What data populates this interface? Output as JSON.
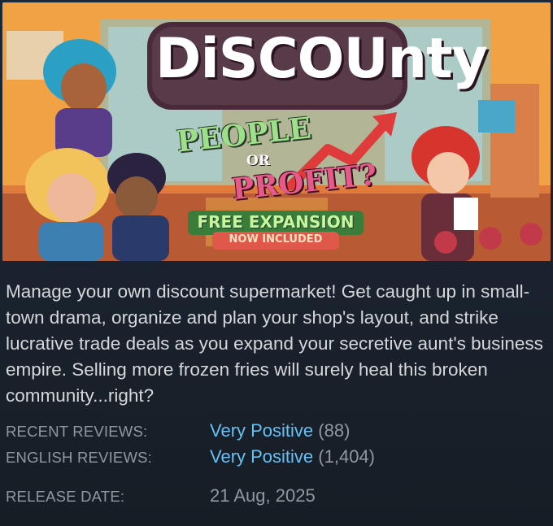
{
  "capsule": {
    "logo_text": "DiSCOUnty",
    "tagline_top": "PEOPLE",
    "tagline_mid": "OR",
    "tagline_bottom": "PROFIT?",
    "badge_line1": "FREE EXPANSION",
    "badge_line2": "NOW INCLUDED"
  },
  "description": "Manage your own discount supermarket! Get caught up in small-town drama, organize and plan your shop's layout, and strike lucrative trade deals as you expand your secretive aunt's business empire. Selling more frozen fries will surely heal this broken community...right?",
  "reviews": {
    "recent_label": "RECENT REVIEWS:",
    "recent_summary": "Very Positive",
    "recent_count": "(88)",
    "english_label": "ENGLISH REVIEWS:",
    "english_summary": "Very Positive",
    "english_count": "(1,404)"
  },
  "release": {
    "label": "RELEASE DATE:",
    "date": "21 Aug, 2025"
  },
  "colors": {
    "background": "#1b2838",
    "positive": "#66c0f4",
    "label": "#8f98a0",
    "text": "#d6d7d8"
  }
}
